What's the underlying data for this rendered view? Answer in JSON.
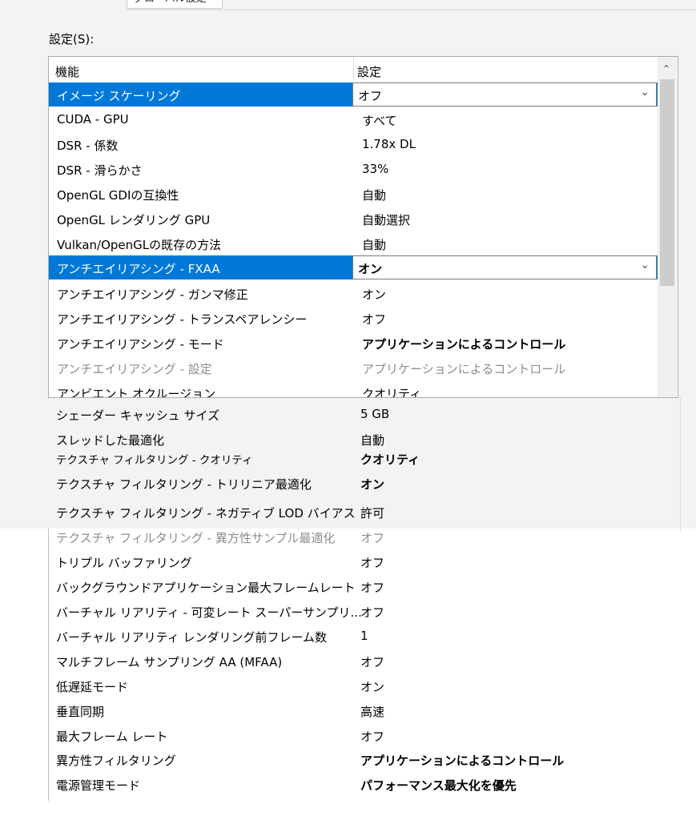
{
  "tab": {
    "label": "グローバル設定"
  },
  "settings_label": "設定(S):",
  "columns": {
    "feature": "機能",
    "setting": "設定"
  },
  "rows": [
    {
      "feature": "イメージ スケーリング",
      "setting": "オフ"
    },
    {
      "feature": "CUDA - GPU",
      "setting": "すべて"
    },
    {
      "feature": "DSR - 係数",
      "setting": "1.78x DL"
    },
    {
      "feature": "DSR - 滑らかさ",
      "setting": "33%"
    },
    {
      "feature": "OpenGL GDIの互換性",
      "setting": "自動"
    },
    {
      "feature": "OpenGL レンダリング GPU",
      "setting": "自動選択"
    },
    {
      "feature": "Vulkan/OpenGLの既存の方法",
      "setting": "自動"
    },
    {
      "feature": "アンチエイリアシング - FXAA",
      "setting": "オン"
    },
    {
      "feature": "アンチエイリアシング - ガンマ修正",
      "setting": "オン"
    },
    {
      "feature": "アンチエイリアシング - トランスペアレンシー",
      "setting": "オフ"
    },
    {
      "feature": "アンチエイリアシング - モード",
      "setting": "アプリケーションによるコントロール"
    },
    {
      "feature": "アンチエイリアシング - 設定",
      "setting": "アプリケーションによるコントロール"
    },
    {
      "feature": "アンビエント オクルージョン",
      "setting": "クオリティ"
    }
  ],
  "lower_rows": [
    {
      "feature": "シェーダー キャッシュ サイズ",
      "setting": "5 GB"
    },
    {
      "feature": "スレッドした最適化",
      "setting": "自動"
    },
    {
      "feature": "テクスチャ フィルタリング - クオリティ",
      "setting": "クオリティ"
    },
    {
      "feature": "テクスチャ フィルタリング - トリリニア最適化",
      "setting": "オン"
    },
    {
      "feature": "テクスチャ フィルタリング - ネガティブ LOD バイアス",
      "setting": "許可"
    },
    {
      "feature": "テクスチャ フィルタリング - 異方性サンプル最適化",
      "setting": "オフ"
    },
    {
      "feature": "トリプル バッファリング",
      "setting": "オフ"
    },
    {
      "feature": "バックグラウンドアプリケーション最大フレームレート",
      "setting": "オフ"
    },
    {
      "feature": "バーチャル リアリティ - 可変レート スーパーサンプリ...",
      "setting": "オフ"
    },
    {
      "feature": "バーチャル リアリティ レンダリング前フレーム数",
      "setting": "1"
    },
    {
      "feature": "マルチフレーム サンプリング AA (MFAA)",
      "setting": "オフ"
    },
    {
      "feature": "低遅延モード",
      "setting": "オン"
    },
    {
      "feature": "垂直同期",
      "setting": "高速"
    },
    {
      "feature": "最大フレーム レート",
      "setting": "オフ"
    },
    {
      "feature": "異方性フィルタリング",
      "setting": "アプリケーションによるコントロール"
    },
    {
      "feature": "電源管理モード",
      "setting": "パフォーマンス最大化を優先"
    }
  ]
}
